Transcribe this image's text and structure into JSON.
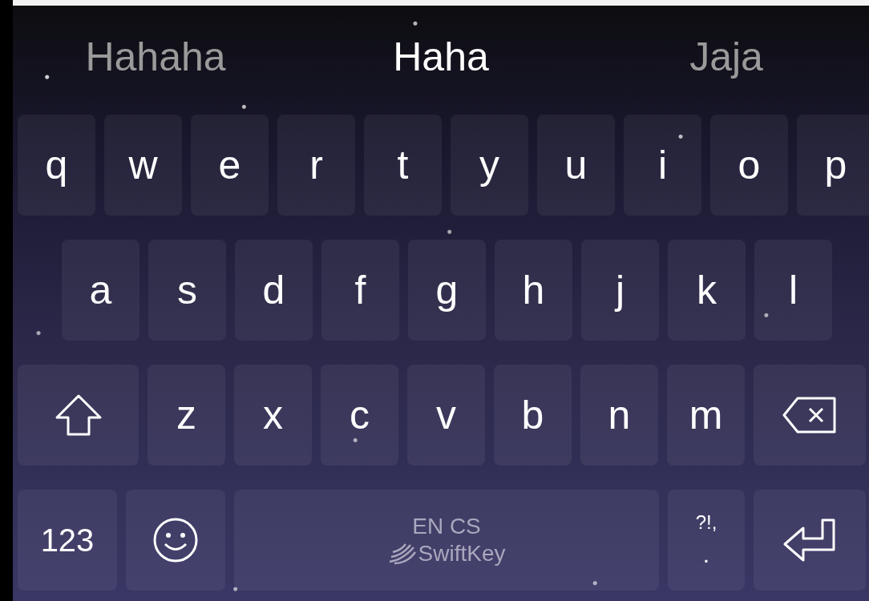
{
  "suggestions": [
    {
      "text": "Hahaha",
      "selected": false
    },
    {
      "text": "Haha",
      "selected": true
    },
    {
      "text": "Jaja",
      "selected": false
    }
  ],
  "rows": [
    {
      "indented": false,
      "keys": [
        {
          "kind": "letter",
          "label": "q"
        },
        {
          "kind": "letter",
          "label": "w"
        },
        {
          "kind": "letter",
          "label": "e"
        },
        {
          "kind": "letter",
          "label": "r"
        },
        {
          "kind": "letter",
          "label": "t"
        },
        {
          "kind": "letter",
          "label": "y"
        },
        {
          "kind": "letter",
          "label": "u"
        },
        {
          "kind": "letter",
          "label": "i"
        },
        {
          "kind": "letter",
          "label": "o"
        },
        {
          "kind": "letter",
          "label": "p"
        }
      ]
    },
    {
      "indented": true,
      "keys": [
        {
          "kind": "letter",
          "label": "a"
        },
        {
          "kind": "letter",
          "label": "s"
        },
        {
          "kind": "letter",
          "label": "d"
        },
        {
          "kind": "letter",
          "label": "f"
        },
        {
          "kind": "letter",
          "label": "g"
        },
        {
          "kind": "letter",
          "label": "h"
        },
        {
          "kind": "letter",
          "label": "j"
        },
        {
          "kind": "letter",
          "label": "k"
        },
        {
          "kind": "letter",
          "label": "l"
        }
      ]
    },
    {
      "indented": false,
      "keys": [
        {
          "kind": "shift"
        },
        {
          "kind": "letter",
          "label": "z"
        },
        {
          "kind": "letter",
          "label": "x"
        },
        {
          "kind": "letter",
          "label": "c"
        },
        {
          "kind": "letter",
          "label": "v"
        },
        {
          "kind": "letter",
          "label": "b"
        },
        {
          "kind": "letter",
          "label": "n"
        },
        {
          "kind": "letter",
          "label": "m"
        },
        {
          "kind": "backspace"
        }
      ]
    },
    {
      "indented": false,
      "keys": [
        {
          "kind": "numbers",
          "label": "123"
        },
        {
          "kind": "emoji"
        },
        {
          "kind": "space",
          "label": "EN CS",
          "brand": "SwiftKey"
        },
        {
          "kind": "punct",
          "label": "?!,",
          "sub": "."
        },
        {
          "kind": "return"
        }
      ]
    }
  ]
}
